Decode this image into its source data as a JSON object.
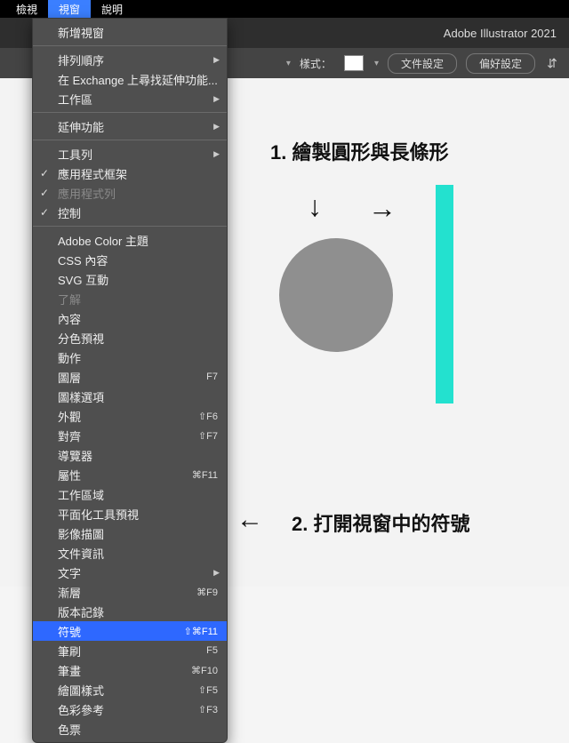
{
  "menubar": {
    "items": [
      "檢視",
      "視窗",
      "說明"
    ],
    "activeIndex": 1
  },
  "appbar": {
    "title": "Adobe Illustrator 2021"
  },
  "toolbar": {
    "style_label": "樣式：",
    "file_setup": "文件設定",
    "pref_setup": "偏好設定"
  },
  "dropdown": [
    {
      "type": "item",
      "label": "新增視窗"
    },
    {
      "type": "sep"
    },
    {
      "type": "item",
      "label": "排列順序",
      "submenu": true
    },
    {
      "type": "item",
      "label": "在 Exchange 上尋找延伸功能..."
    },
    {
      "type": "item",
      "label": "工作區",
      "submenu": true
    },
    {
      "type": "sep"
    },
    {
      "type": "item",
      "label": "延伸功能",
      "submenu": true
    },
    {
      "type": "sep"
    },
    {
      "type": "item",
      "label": "工具列",
      "submenu": true
    },
    {
      "type": "item",
      "label": "應用程式框架",
      "checked": true
    },
    {
      "type": "item",
      "label": "應用程式列",
      "checked": true,
      "disabled": true
    },
    {
      "type": "item",
      "label": "控制",
      "checked": true
    },
    {
      "type": "sep"
    },
    {
      "type": "item",
      "label": "Adobe Color 主題"
    },
    {
      "type": "item",
      "label": "CSS 內容"
    },
    {
      "type": "item",
      "label": "SVG 互動"
    },
    {
      "type": "item",
      "label": "了解",
      "disabled": true
    },
    {
      "type": "item",
      "label": "內容"
    },
    {
      "type": "item",
      "label": "分色預視"
    },
    {
      "type": "item",
      "label": "動作"
    },
    {
      "type": "item",
      "label": "圖層",
      "shortcut": "F7"
    },
    {
      "type": "item",
      "label": "圖樣選項"
    },
    {
      "type": "item",
      "label": "外觀",
      "shortcut": "⇧F6"
    },
    {
      "type": "item",
      "label": "對齊",
      "shortcut": "⇧F7"
    },
    {
      "type": "item",
      "label": "導覽器"
    },
    {
      "type": "item",
      "label": "屬性",
      "shortcut": "⌘F11"
    },
    {
      "type": "item",
      "label": "工作區域"
    },
    {
      "type": "item",
      "label": "平面化工具預視"
    },
    {
      "type": "item",
      "label": "影像描圖"
    },
    {
      "type": "item",
      "label": "文件資訊"
    },
    {
      "type": "item",
      "label": "文字",
      "submenu": true
    },
    {
      "type": "item",
      "label": "漸層",
      "shortcut": "⌘F9"
    },
    {
      "type": "item",
      "label": "版本記錄"
    },
    {
      "type": "item",
      "label": "符號",
      "shortcut": "⇧⌘F11",
      "highlight": true
    },
    {
      "type": "item",
      "label": "筆刷",
      "shortcut": "F5"
    },
    {
      "type": "item",
      "label": "筆畫",
      "shortcut": "⌘F10"
    },
    {
      "type": "item",
      "label": "繪圖樣式",
      "shortcut": "⇧F5"
    },
    {
      "type": "item",
      "label": "色彩參考",
      "shortcut": "⇧F3"
    },
    {
      "type": "item",
      "label": "色票"
    }
  ],
  "annotations": {
    "step1": "1. 繪製圓形與長條形",
    "step2": "2. 打開視窗中的符號"
  },
  "chart_data": {
    "type": "diagram",
    "shapes": [
      {
        "kind": "circle",
        "fill": "#8f8f8f"
      },
      {
        "kind": "rect",
        "fill": "#23e1cf"
      }
    ],
    "title": "繪製圓形與長條形"
  },
  "arrows": {
    "down": "↓",
    "right": "→",
    "left": "←"
  }
}
